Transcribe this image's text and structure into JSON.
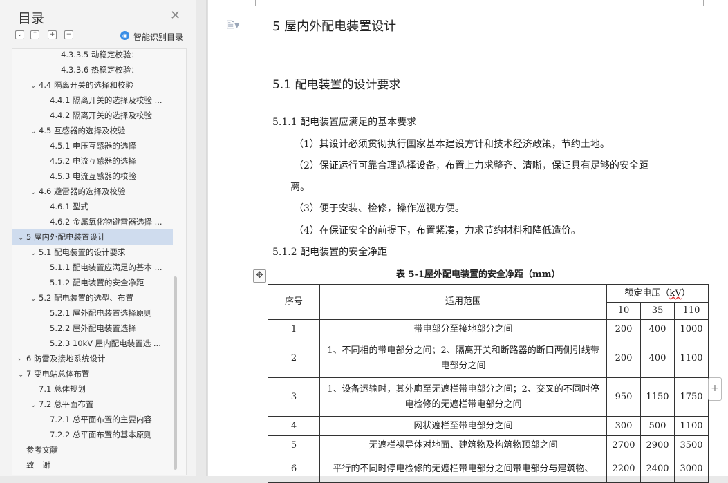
{
  "nav": {
    "title": "目录",
    "smart_toc_label": "智能识别目录",
    "items": [
      {
        "label": "4.3.3.5 动稳定校验：",
        "indent": 3,
        "arrow": ""
      },
      {
        "label": "4.3.3.6 热稳定校验：",
        "indent": 3,
        "arrow": ""
      },
      {
        "label": "4.4 隔离开关的选择和校验",
        "indent": 1,
        "arrow": "⌄"
      },
      {
        "label": "4.4.1 隔离开关的选择及校验 ...",
        "indent": 2,
        "arrow": ""
      },
      {
        "label": "4.4.2 隔离开关的选择及校验",
        "indent": 2,
        "arrow": ""
      },
      {
        "label": "4.5 互感器的选择及校验",
        "indent": 1,
        "arrow": "⌄"
      },
      {
        "label": "4.5.1 电压互感器的选择",
        "indent": 2,
        "arrow": ""
      },
      {
        "label": "4.5.2 电流互感器的选择",
        "indent": 2,
        "arrow": ""
      },
      {
        "label": "4.5.3 电流互感器的校验",
        "indent": 2,
        "arrow": ""
      },
      {
        "label": "4.6 避雷器的选择及校验",
        "indent": 1,
        "arrow": "⌄"
      },
      {
        "label": "4.6.1 型式",
        "indent": 2,
        "arrow": ""
      },
      {
        "label": "4.6.2 金属氧化物避雷器选择 ...",
        "indent": 2,
        "arrow": ""
      },
      {
        "label": "5 屋内外配电装置设计",
        "indent": 0,
        "arrow": "⌄",
        "selected": true
      },
      {
        "label": "5.1 配电装置的设计要求",
        "indent": 1,
        "arrow": "⌄"
      },
      {
        "label": "5.1.1 配电装置应满足的基本 ...",
        "indent": 2,
        "arrow": ""
      },
      {
        "label": "5.1.2 配电装置的安全净距",
        "indent": 2,
        "arrow": ""
      },
      {
        "label": "5.2 配电装置的选型、布置",
        "indent": 1,
        "arrow": "⌄"
      },
      {
        "label": "5.2.1 屋外配电装置选择原则",
        "indent": 2,
        "arrow": ""
      },
      {
        "label": "5.2.2 屋外配电装置选择",
        "indent": 2,
        "arrow": ""
      },
      {
        "label": "5.2.3 10kV 屋内配电装置选 ...",
        "indent": 2,
        "arrow": ""
      },
      {
        "label": "6 防雷及接地系统设计",
        "indent": 0,
        "arrow": "›"
      },
      {
        "label": "7 变电站总体布置",
        "indent": 0,
        "arrow": "⌄"
      },
      {
        "label": "7.1 总体规划",
        "indent": 1,
        "arrow": ""
      },
      {
        "label": "7.2 总平面布置",
        "indent": 1,
        "arrow": "⌄"
      },
      {
        "label": "7.2.1 总平面布置的主要内容",
        "indent": 2,
        "arrow": ""
      },
      {
        "label": "7.2.2 总平面布置的基本原则",
        "indent": 2,
        "arrow": ""
      },
      {
        "label": "参考文献",
        "indent": 0,
        "arrow": ""
      },
      {
        "label": "致　谢",
        "indent": 0,
        "arrow": ""
      }
    ]
  },
  "doc": {
    "chapter_title": "5  屋内外配电装置设计",
    "section_title": "5.1  配电装置的设计要求",
    "sub1_title": "5.1.1  配电装置应满足的基本要求",
    "para1": "（1）其设计必须贯彻执行国家基本建设方针和技术经济政策，节约土地。",
    "para2a": "（2）保证运行可靠合理选择设备，布置上力求整齐、清晰，保证具有足够的安全距",
    "para2b": "离。",
    "para3": "（3）便于安装、检修，操作巡视方便。",
    "para4": "（4）在保证安全的前提下，布置紧凑，力求节约材料和降低造价。",
    "sub2_title": "5.1.2  配电装置的安全净距",
    "table_caption": "表 5-1屋外配电装置的安全净距（mm）",
    "table": {
      "h_index": "序号",
      "h_range": "适用范围",
      "h_voltage_prefix": "额定电压（",
      "h_voltage_unit": "kV",
      "h_voltage_suffix": "）",
      "h_v10": "10",
      "h_v35": "35",
      "h_v110": "110",
      "rows": [
        {
          "idx": "1",
          "range": "带电部分至接地部分之间",
          "v10": "200",
          "v35": "400",
          "v110": "1000"
        },
        {
          "idx": "2",
          "range": "1、不同相的带电部分之间；2、隔离开关和断路器的断口两侧引线带电部分之间",
          "v10": "200",
          "v35": "400",
          "v110": "1100"
        },
        {
          "idx": "3",
          "range": "1、设备运输时，其外廓至无遮栏带电部分之间；2、交叉的不同时停电检修的无遮栏带电部分之间",
          "v10": "950",
          "v35": "1150",
          "v110": "1750"
        },
        {
          "idx": "4",
          "range": "网状遮栏至带电部分之间",
          "v10": "300",
          "v35": "500",
          "v110": "1100"
        },
        {
          "idx": "5",
          "range": "无遮栏裸导体对地面、建筑物及构筑物顶部之间",
          "v10": "2700",
          "v35": "2900",
          "v110": "3500"
        },
        {
          "idx": "6",
          "range": "平行的不同时停电检修的无遮栏带电部分之间带电部分与建筑物、",
          "v10": "2200",
          "v35": "2400",
          "v110": "3000"
        }
      ]
    }
  }
}
